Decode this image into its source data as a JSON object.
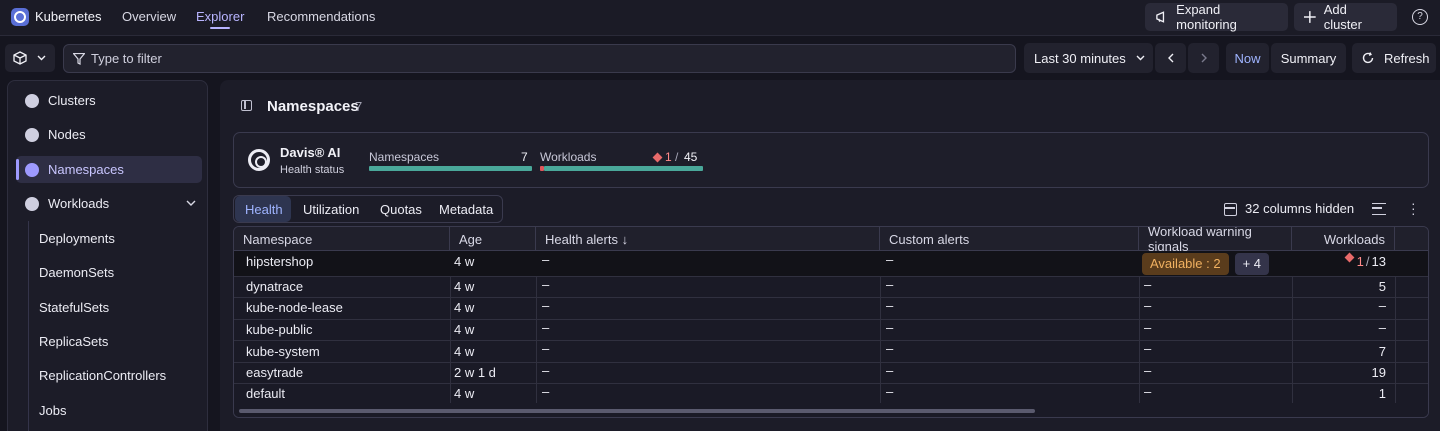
{
  "topbar": {
    "app_title": "Kubernetes",
    "nav": [
      "Overview",
      "Explorer",
      "Recommendations"
    ],
    "expand_monitoring": "Expand monitoring",
    "add_cluster": "Add cluster"
  },
  "toolbar": {
    "filter_placeholder": "Type to filter",
    "timeframe": "Last 30 minutes",
    "now": "Now",
    "summary": "Summary",
    "refresh": "Refresh"
  },
  "sidebar": {
    "items": [
      "Clusters",
      "Nodes",
      "Namespaces",
      "Workloads"
    ],
    "workload_children": [
      "Deployments",
      "DaemonSets",
      "StatefulSets",
      "ReplicaSets",
      "ReplicationControllers",
      "Jobs"
    ],
    "active": "Namespaces"
  },
  "page": {
    "title": "Namespaces",
    "count": "7"
  },
  "davis": {
    "name": "Davis® AI",
    "subtitle": "Health status",
    "namespaces_label": "Namespaces",
    "namespaces_value": "7",
    "workloads_label": "Workloads",
    "workloads_problem": "1",
    "workloads_sep": "/",
    "workloads_total": "45",
    "workloads_problem_fraction": 0.022
  },
  "tabs": [
    "Health",
    "Utilization",
    "Quotas",
    "Metadata"
  ],
  "active_tab": "Health",
  "columns_hidden": "32 columns hidden",
  "table": {
    "headers": [
      "Namespace",
      "Age",
      "Health alerts ↓",
      "Custom alerts",
      "Workload warning signals",
      "Workloads"
    ],
    "rows": [
      {
        "namespace": "hipstershop",
        "age": "4 w",
        "health": "–",
        "custom": "–",
        "warning": "",
        "workloads": "13",
        "problem": "1",
        "sep": "/"
      },
      {
        "namespace": "dynatrace",
        "age": "4 w",
        "health": "–",
        "custom": "–",
        "warning": "–",
        "workloads": "5"
      },
      {
        "namespace": "kube-node-lease",
        "age": "4 w",
        "health": "–",
        "custom": "–",
        "warning": "–",
        "workloads": "–"
      },
      {
        "namespace": "kube-public",
        "age": "4 w",
        "health": "–",
        "custom": "–",
        "warning": "–",
        "workloads": "–"
      },
      {
        "namespace": "kube-system",
        "age": "4 w",
        "health": "–",
        "custom": "–",
        "warning": "–",
        "workloads": "7"
      },
      {
        "namespace": "easytrade",
        "age": "2 w 1 d",
        "health": "–",
        "custom": "–",
        "warning": "–",
        "workloads": "19"
      },
      {
        "namespace": "default",
        "age": "4 w",
        "health": "–",
        "custom": "–",
        "warning": "–",
        "workloads": "1"
      }
    ],
    "hipstershop_signal": "Available : 2",
    "hipstershop_more": "+ 4"
  },
  "colors": {
    "accent": "#b8b4ff",
    "bar_ok": "#4aa89a",
    "bar_problem": "#e0555a",
    "warning": "#f0b060"
  }
}
